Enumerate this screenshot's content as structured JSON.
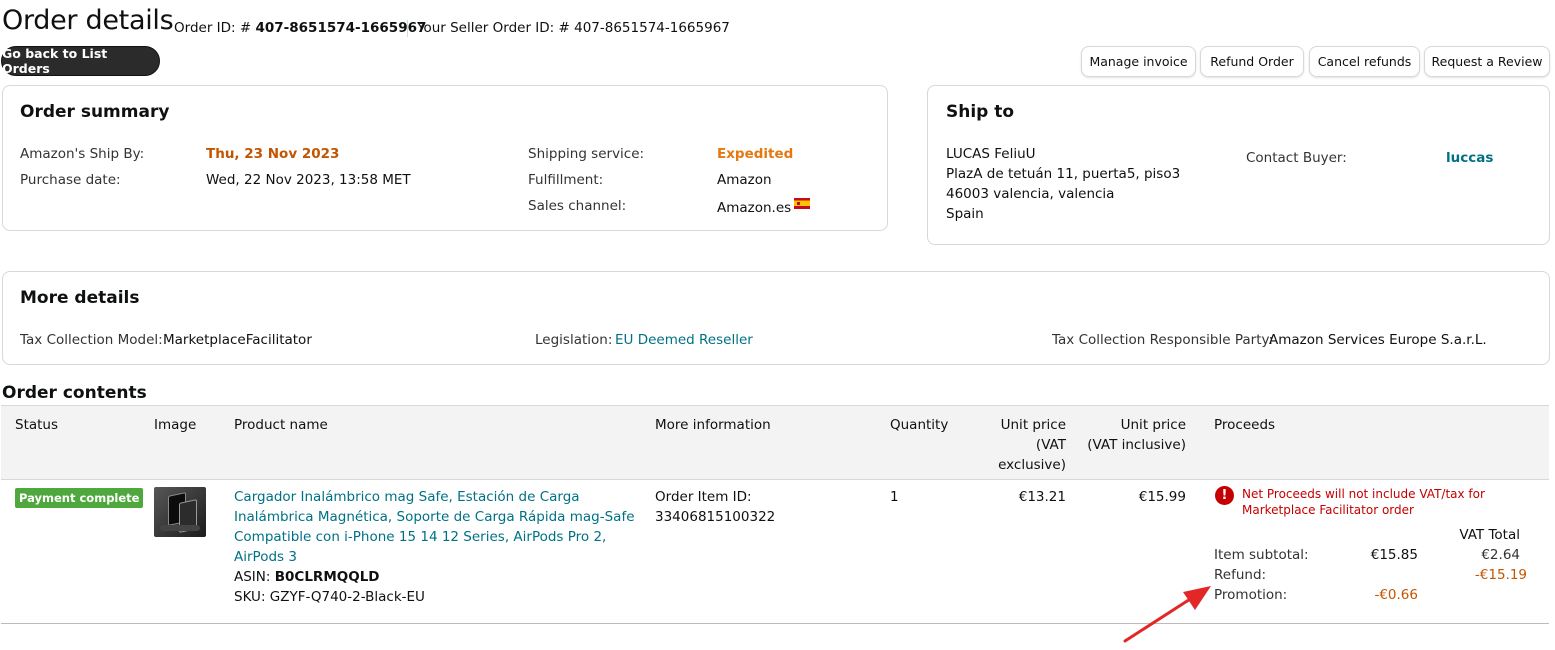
{
  "header": {
    "title": "Order details",
    "order_id_label": "Order ID: # ",
    "order_id": "407-8651574-1665967",
    "seller_order_id_label": "Your Seller Order ID: # 407-8651574-1665967",
    "back_button": "Go back to List Orders"
  },
  "actions": {
    "manage_invoice": "Manage invoice",
    "refund_order": "Refund Order",
    "cancel_refunds": "Cancel refunds",
    "request_review": "Request a Review"
  },
  "order_summary": {
    "title": "Order summary",
    "ship_by_label": "Amazon's Ship By:",
    "ship_by_value": "Thu, 23 Nov 2023",
    "purchase_date_label": "Purchase date:",
    "purchase_date_value": "Wed, 22 Nov 2023, 13:58 MET",
    "shipping_service_label": "Shipping service:",
    "shipping_service_value": "Expedited",
    "fulfillment_label": "Fulfillment:",
    "fulfillment_value": "Amazon",
    "sales_channel_label": "Sales channel:",
    "sales_channel_value": "Amazon.es",
    "flag_icon": "spain-flag-icon"
  },
  "ship_to": {
    "title": "Ship to",
    "address_lines": [
      "LUCAS FeliuU",
      "PlazA de tetuán 11, puerta5, piso3",
      "46003 valencia, valencia",
      "Spain"
    ],
    "contact_label": "Contact Buyer:",
    "contact_value": "luccas"
  },
  "more_details": {
    "title": "More details",
    "tax_model_label": "Tax Collection Model:",
    "tax_model_value": "MarketplaceFacilitator",
    "legislation_label": "Legislation:",
    "legislation_value": "EU Deemed Reseller",
    "responsible_label": "Tax Collection Responsible Party:",
    "responsible_value": "Amazon Services Europe S.a.r.L."
  },
  "order_contents": {
    "title": "Order contents",
    "columns": {
      "status": "Status",
      "image": "Image",
      "product": "Product name",
      "more_info": "More information",
      "quantity": "Quantity",
      "unit_price_excl_lines": [
        "Unit price",
        "(VAT",
        "exclusive)"
      ],
      "unit_price_incl_lines": [
        "Unit price",
        "(VAT inclusive)"
      ],
      "proceeds": "Proceeds"
    },
    "row": {
      "status_badge": "Payment complete",
      "product_name_lines": [
        "Cargador Inalámbrico mag Safe, Estación de Carga",
        "Inalámbrica Magnética, Soporte de Carga Rápida mag-Safe",
        "Compatible con i-Phone 15 14 12 Series, AirPods Pro 2,",
        "AirPods 3"
      ],
      "asin_label": "ASIN: ",
      "asin": "B0CLRMQQLD",
      "sku": "SKU: GZYF-Q740-2-Black-EU",
      "order_item_id_label": "Order Item ID:",
      "order_item_id": "33406815100322",
      "quantity": "1",
      "unit_price_excl": "€13.21",
      "unit_price_incl": "€15.99"
    },
    "proceeds": {
      "warning": "Net Proceeds will not include VAT/tax for Marketplace Facilitator order",
      "vat_total_header": "VAT Total",
      "item_subtotal_label": "Item subtotal:",
      "item_subtotal_value": "€15.85",
      "item_subtotal_vat": "€2.64",
      "refund_label": "Refund:",
      "refund_vat": "-€15.19",
      "promotion_label": "Promotion:",
      "promotion_value": "-€0.66"
    }
  },
  "colors": {
    "accent_orange": "#c45500",
    "link_teal": "#007185",
    "badge_green": "#4fa83d",
    "warning_red": "#c40000",
    "annotation_arrow": "#e32727"
  }
}
